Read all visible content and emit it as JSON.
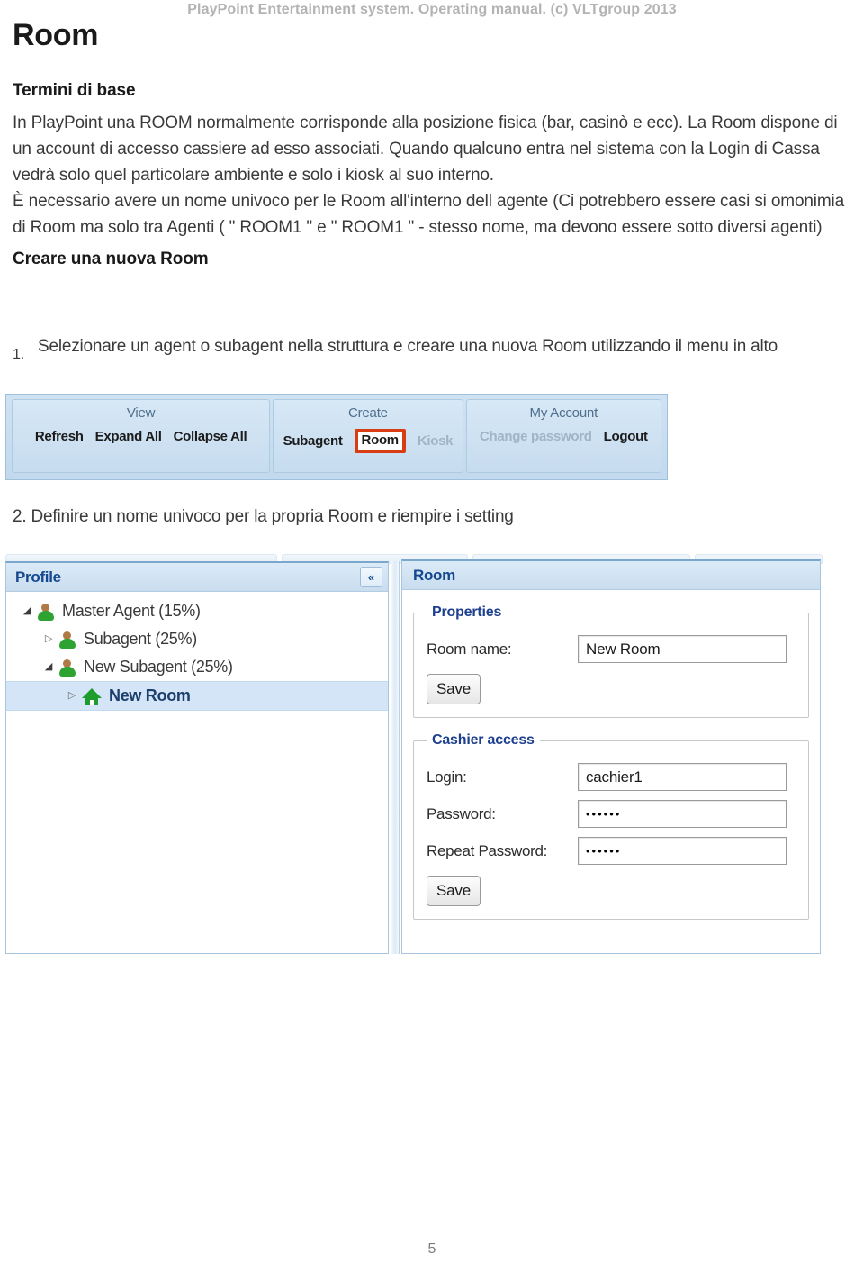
{
  "running_header": "PlayPoint Entertainment system. Operating manual. (c) VLTgroup 2013",
  "page_title": "Room",
  "page_number": "5",
  "sections": {
    "terms_heading": "Termini di base",
    "para1": "In PlayPoint una ROOM normalmente corrisponde alla posizione fisica (bar, casinò e ecc). La Room dispone di un account di accesso cassiere ad esso associati. Quando qualcuno entra nel sistema con la Login di Cassa vedrà solo quel particolare ambiente e solo i kiosk al suo interno.",
    "para2": "È necessario avere un nome univoco per le Room all'interno dell agente (Ci potrebbero essere casi si omonimia di Room ma solo tra Agenti ( \" ROOM1 \" e \" ROOM1 \" - stesso nome, ma devono essere sotto diversi agenti)",
    "create_heading": "Creare una nuova Room",
    "step1_number": "1.",
    "step1_text": "Selezionare un agent o subagent nella struttura e creare una nuova Room utilizzando il menu in alto",
    "step2_text": "2. Definire un nome univoco per la propria Room e riempire i setting"
  },
  "toolbar": {
    "groups": [
      {
        "title": "View",
        "items": [
          {
            "label": "Refresh",
            "state": "normal"
          },
          {
            "label": "Expand All",
            "state": "normal"
          },
          {
            "label": "Collapse All",
            "state": "normal"
          }
        ]
      },
      {
        "title": "Create",
        "items": [
          {
            "label": "Subagent",
            "state": "normal"
          },
          {
            "label": "Room",
            "state": "highlight"
          },
          {
            "label": "Kiosk",
            "state": "disabled"
          }
        ]
      },
      {
        "title": "My Account",
        "items": [
          {
            "label": "Change password",
            "state": "disabled"
          },
          {
            "label": "Logout",
            "state": "normal"
          }
        ]
      }
    ],
    "highlight_color": "#d93d14"
  },
  "app": {
    "profile_panel": {
      "title": "Profile",
      "collapse_icon": "«",
      "tree": [
        {
          "label": "Master Agent (15%)",
          "icon": "person-icon",
          "twisty": "◢",
          "expanded": true,
          "selected": false,
          "depth": 0
        },
        {
          "label": "Subagent (25%)",
          "icon": "person-icon",
          "twisty": "▷",
          "expanded": false,
          "selected": false,
          "depth": 1
        },
        {
          "label": "New Subagent (25%)",
          "icon": "person-icon",
          "twisty": "◢",
          "expanded": true,
          "selected": false,
          "depth": 1
        },
        {
          "label": "New Room",
          "icon": "house-icon",
          "twisty": "▷",
          "expanded": false,
          "selected": true,
          "depth": 2
        }
      ]
    },
    "room_panel": {
      "title": "Room",
      "properties": {
        "legend": "Properties",
        "room_name_label": "Room name:",
        "room_name_value": "New Room",
        "save_label": "Save"
      },
      "cashier": {
        "legend": "Cashier access",
        "login_label": "Login:",
        "login_value": "cachier1",
        "password_label": "Password:",
        "password_value": "••••••",
        "repeat_label": "Repeat Password:",
        "repeat_value": "••••••",
        "save_label": "Save"
      }
    }
  }
}
